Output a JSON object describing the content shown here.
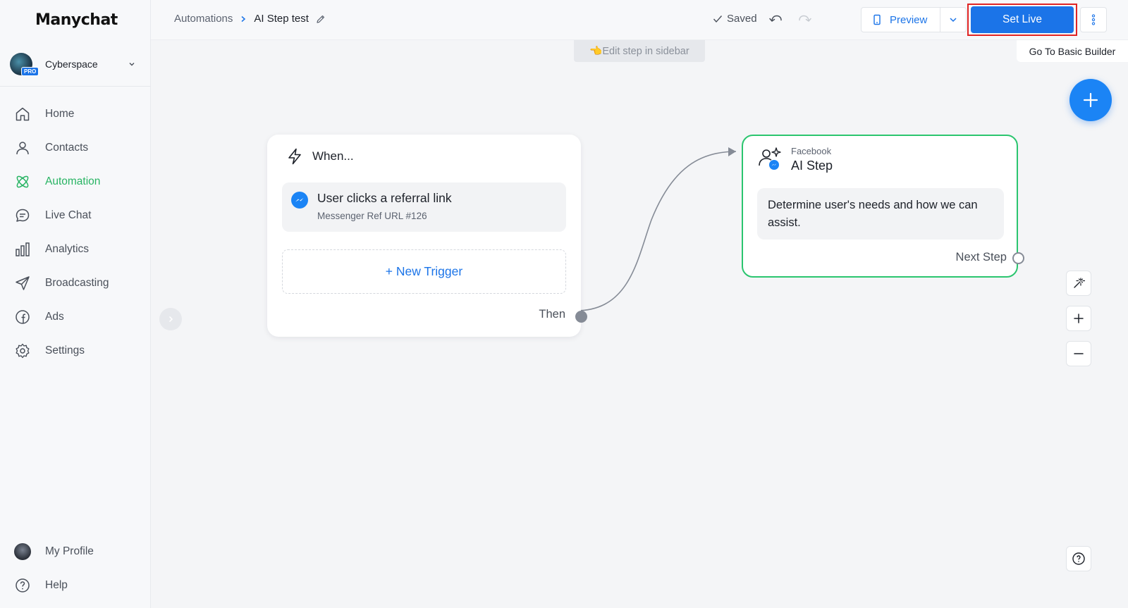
{
  "app": {
    "logo": "Manychat"
  },
  "account": {
    "name": "Cyberspace",
    "badge": "PRO"
  },
  "sidebar": {
    "items": [
      {
        "label": "Home",
        "icon": "home-icon"
      },
      {
        "label": "Contacts",
        "icon": "user-icon"
      },
      {
        "label": "Automation",
        "icon": "automation-icon",
        "active": true
      },
      {
        "label": "Live Chat",
        "icon": "chat-icon"
      },
      {
        "label": "Analytics",
        "icon": "bar-chart-icon"
      },
      {
        "label": "Broadcasting",
        "icon": "send-icon"
      },
      {
        "label": "Ads",
        "icon": "facebook-icon"
      },
      {
        "label": "Settings",
        "icon": "gear-icon"
      }
    ],
    "bottom": [
      {
        "label": "My Profile",
        "icon": "avatar"
      },
      {
        "label": "Help",
        "icon": "help-icon"
      }
    ]
  },
  "header": {
    "breadcrumb_parent": "Automations",
    "breadcrumb_current": "AI Step test",
    "status": "Saved",
    "preview_label": "Preview",
    "set_live_label": "Set Live"
  },
  "canvas": {
    "hint": "👈Edit step in sidebar",
    "basic_builder": "Go To Basic Builder",
    "trigger_node": {
      "heading": "When...",
      "trigger_title": "User clicks a referral link",
      "trigger_subtitle": "Messenger Ref URL #126",
      "new_trigger": "+ New Trigger",
      "then_label": "Then"
    },
    "ai_node": {
      "platform": "Facebook",
      "title": "AI Step",
      "body": "Determine user's needs and how we can assist.",
      "next_label": "Next Step"
    }
  },
  "colors": {
    "accent": "#1b74e8",
    "active_green": "#28b463",
    "node_border_green": "#2bc56f",
    "highlight_red": "#e02424"
  }
}
